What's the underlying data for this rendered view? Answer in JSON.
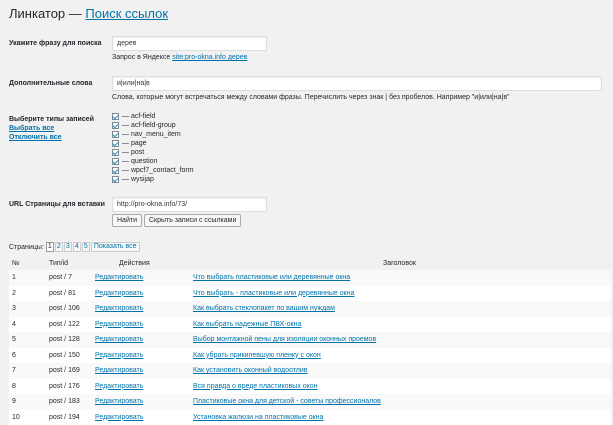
{
  "header": {
    "title_plain": "Линкатор — ",
    "title_link": "Поиск ссылок"
  },
  "phrase": {
    "label": "Укажите фразу для поиска",
    "value": "дерев",
    "hint_prefix": "Запрос в Яндексе ",
    "hint_link": "site:pro-okna.info дерев"
  },
  "extra": {
    "label": "Дополнительные слова",
    "value": "и|или|на|в",
    "hint": "Слова, которые могут встречаться между словами фразы. Перечислить через знак | без пробелов. Например \"и|или|на|в\""
  },
  "types": {
    "label": "Выберите типы записей",
    "select_all": "Выбрать все",
    "deselect_all": "Отключить все",
    "items": [
      "— acf-field",
      "— acf-field-group",
      "— nav_menu_item",
      "— page",
      "— post",
      "— question",
      "— wpcf7_contact_form",
      "— wysijap"
    ]
  },
  "url": {
    "label": "URL Страницы для вставки",
    "value": "http://pro-okna.info/73/",
    "find_button": "Найти",
    "hide_button": "Скрыть записи с ссылками"
  },
  "pager": {
    "label": "Страницы:",
    "pages": [
      "1",
      "2",
      "3",
      "4",
      "5"
    ],
    "show_all": "Показать все"
  },
  "table": {
    "headers": [
      "№",
      "Тип/id",
      "Действия",
      "Заголовок"
    ],
    "rows": [
      {
        "n": "1",
        "type": "post / 7",
        "action": "Редактировать",
        "title": "Что выбрать пластиковые или деревянные окна"
      },
      {
        "n": "2",
        "type": "post / 81",
        "action": "Редактировать",
        "title": "Что выбрать - пластиковые или деревянные окна"
      },
      {
        "n": "3",
        "type": "post / 106",
        "action": "Редактировать",
        "title": "Как выбрать стеклопакет по вашим нуждам"
      },
      {
        "n": "4",
        "type": "post / 122",
        "action": "Редактировать",
        "title": "Как выбрать надежные ПВХ-окна"
      },
      {
        "n": "5",
        "type": "post / 128",
        "action": "Редактировать",
        "title": "Выбор монтажной пены для изоляции оконных проемов"
      },
      {
        "n": "6",
        "type": "post / 150",
        "action": "Редактировать",
        "title": "Как убрать прикипевшую пленку с окон"
      },
      {
        "n": "7",
        "type": "post / 169",
        "action": "Редактировать",
        "title": "Как установить оконный водоотлив"
      },
      {
        "n": "8",
        "type": "post / 176",
        "action": "Редактировать",
        "title": "Вся правда о вреде пластиковых окон"
      },
      {
        "n": "9",
        "type": "post / 183",
        "action": "Редактировать",
        "title": "Пластиковые окна для детской - советы профессионалов"
      },
      {
        "n": "10",
        "type": "post / 194",
        "action": "Редактировать",
        "title": "Установка жалюзи на пластиковые окна"
      }
    ]
  }
}
